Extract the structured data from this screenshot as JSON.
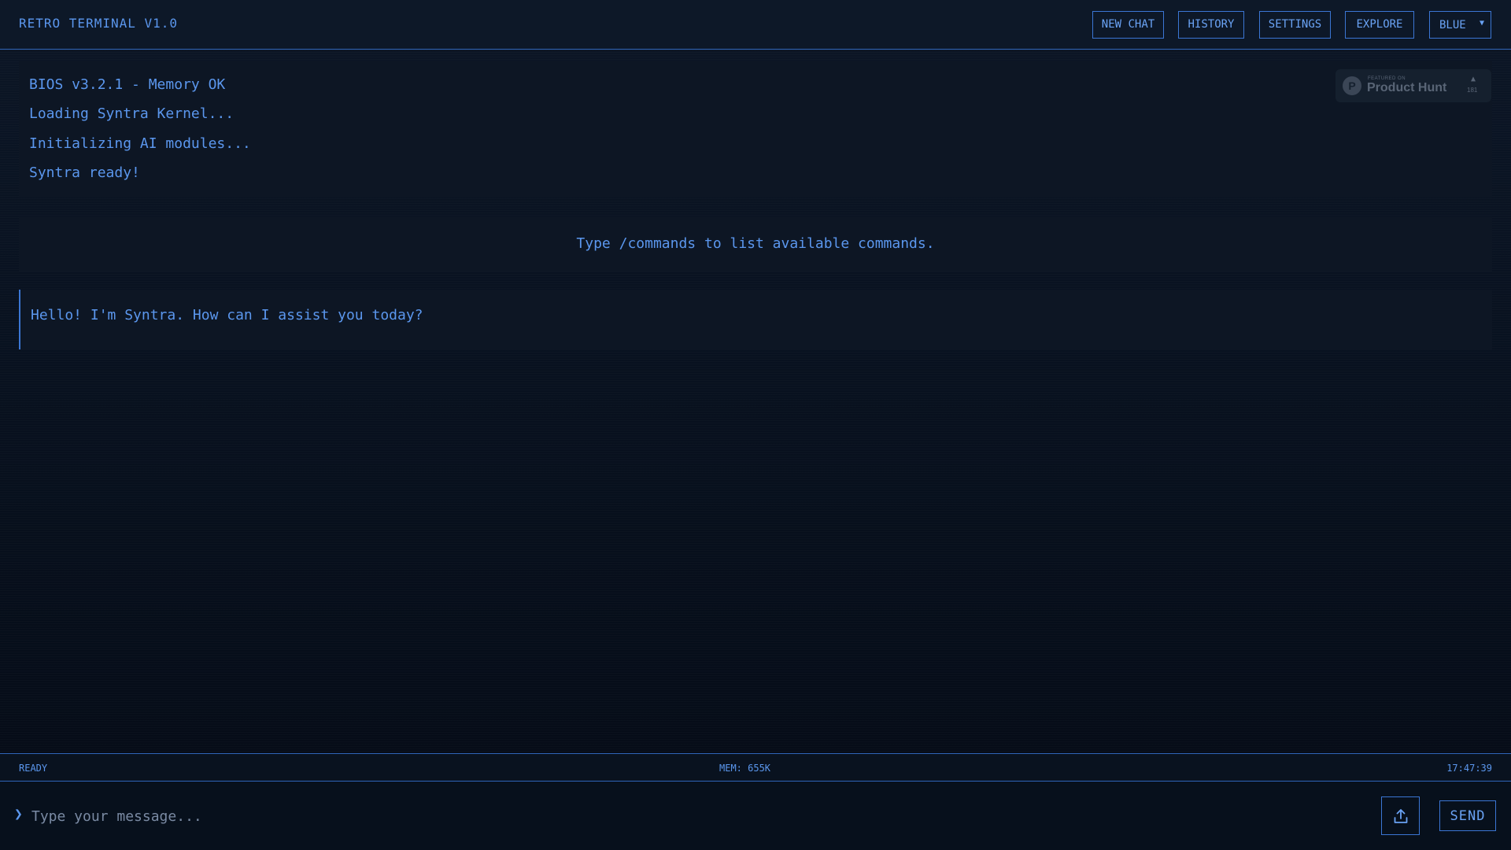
{
  "app": {
    "title": "RETRO TERMINAL V1.0"
  },
  "nav": {
    "new_chat": "NEW CHAT",
    "history": "HISTORY",
    "settings": "SETTINGS",
    "explore": "EXPLORE",
    "theme": "BLUE"
  },
  "boot": {
    "lines": [
      "BIOS v3.2.1 - Memory OK",
      "Loading Syntra Kernel...",
      "Initializing AI modules...",
      "Syntra ready!"
    ]
  },
  "badge": {
    "featured": "FEATURED ON",
    "name": "Product Hunt",
    "votes": "181",
    "icon": "product-hunt-p"
  },
  "hint": {
    "text": "Type /commands to list available commands."
  },
  "message": {
    "text": "Hello! I'm Syntra. How can I assist you today?"
  },
  "status": {
    "state": "READY",
    "memory": "MEM: 655K",
    "time": "17:47:39"
  },
  "input": {
    "placeholder": "Type your message...",
    "send": "SEND",
    "prompt_icon": "chevron-right"
  },
  "colors": {
    "accent": "#5b97ee",
    "border": "#3b76d4",
    "background": "#060d18"
  }
}
